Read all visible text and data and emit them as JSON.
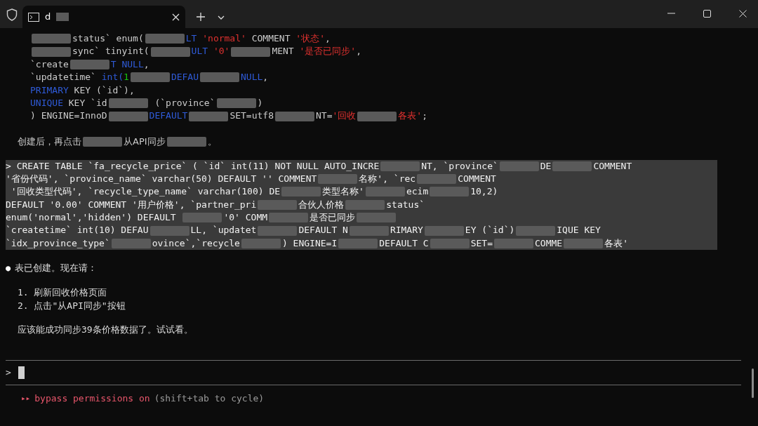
{
  "tab": {
    "title": "d",
    "selected": true
  },
  "code_lines": [
    [
      {
        "kind": "redacted"
      },
      {
        "kind": "plain",
        "text": "status` enum("
      },
      {
        "kind": "redacted"
      },
      {
        "kind": "keyword",
        "text": "LT"
      },
      {
        "kind": "string",
        "text": " 'normal'"
      },
      {
        "kind": "plain",
        "text": " COMMENT "
      },
      {
        "kind": "string",
        "text": "'状态'"
      },
      {
        "kind": "plain",
        "text": ","
      }
    ],
    [
      {
        "kind": "redacted"
      },
      {
        "kind": "plain",
        "text": "sync` tinyint("
      },
      {
        "kind": "redacted"
      },
      {
        "kind": "keyword",
        "text": "ULT"
      },
      {
        "kind": "string",
        "text": " '0'"
      },
      {
        "kind": "redacted"
      },
      {
        "kind": "plain",
        "text": "MENT "
      },
      {
        "kind": "string",
        "text": "'是否已同步'"
      },
      {
        "kind": "plain",
        "text": ","
      }
    ],
    [
      {
        "kind": "plain",
        "text": "`create"
      },
      {
        "kind": "redacted"
      },
      {
        "kind": "keyword",
        "text": "T NULL"
      },
      {
        "kind": "plain",
        "text": ","
      }
    ],
    [
      {
        "kind": "plain",
        "text": "`updatetime` "
      },
      {
        "kind": "keyword",
        "text": "int("
      },
      {
        "kind": "number",
        "text": "1"
      },
      {
        "kind": "redacted"
      },
      {
        "kind": "keyword",
        "text": "DEFAU"
      },
      {
        "kind": "redacted"
      },
      {
        "kind": "keyword",
        "text": "NULL"
      },
      {
        "kind": "plain",
        "text": ","
      }
    ],
    [
      {
        "kind": "keyword",
        "text": "PRIMARY"
      },
      {
        "kind": "plain",
        "text": " KEY (`id`),"
      }
    ],
    [
      {
        "kind": "keyword",
        "text": "UNIQUE"
      },
      {
        "kind": "plain",
        "text": " KEY `id"
      },
      {
        "kind": "redacted"
      },
      {
        "kind": "plain",
        "text": " (`province`"
      },
      {
        "kind": "redacted"
      },
      {
        "kind": "plain",
        "text": ")"
      }
    ],
    [
      {
        "kind": "plain",
        "text": ") ENGINE=InnoD"
      },
      {
        "kind": "redacted"
      },
      {
        "kind": "keyword",
        "text": "DEFAULT"
      },
      {
        "kind": "redacted"
      },
      {
        "kind": "plain",
        "text": "SET=utf8"
      },
      {
        "kind": "redacted"
      },
      {
        "kind": "plain",
        "text": "NT="
      },
      {
        "kind": "string",
        "text": "'回收"
      },
      {
        "kind": "redacted"
      },
      {
        "kind": "string",
        "text": "各表'"
      },
      {
        "kind": "plain",
        "text": ";"
      }
    ]
  ],
  "note_line": [
    {
      "kind": "plain",
      "text": "创建后，再点击"
    },
    {
      "kind": "redacted"
    },
    {
      "kind": "plain",
      "text": "从API同步"
    },
    {
      "kind": "redacted"
    },
    {
      "kind": "plain",
      "text": "。"
    }
  ],
  "selected_lines": [
    [
      {
        "kind": "plain",
        "text": "> CREATE TABLE `fa_recycle_price` ( `id` int(11) NOT NULL AUTO_INCRE"
      },
      {
        "kind": "redacted"
      },
      {
        "kind": "plain",
        "text": "NT, `province`"
      },
      {
        "kind": "redacted"
      },
      {
        "kind": "plain",
        "text": "DE"
      },
      {
        "kind": "redacted"
      },
      {
        "kind": "plain",
        "text": "COMMENT"
      }
    ],
    [
      {
        "kind": "plain",
        "text": "'省份代码', `province_name` varchar(50) DEFAULT '' COMMENT"
      },
      {
        "kind": "redacted"
      },
      {
        "kind": "plain",
        "text": "名称', `rec"
      },
      {
        "kind": "redacted"
      },
      {
        "kind": "plain",
        "text": "COMMENT"
      }
    ],
    [
      {
        "kind": "plain",
        "text": " '回收类型代码', `recycle_type_name` varchar(100) DE"
      },
      {
        "kind": "redacted"
      },
      {
        "kind": "plain",
        "text": "类型名称'"
      },
      {
        "kind": "redacted"
      },
      {
        "kind": "plain",
        "text": "ecim"
      },
      {
        "kind": "redacted"
      },
      {
        "kind": "plain",
        "text": "10,2)"
      }
    ],
    [
      {
        "kind": "plain",
        "text": "DEFAULT '0.00' COMMENT '用户价格', `partner_pri"
      },
      {
        "kind": "redacted"
      },
      {
        "kind": "plain",
        "text": "合伙人价格"
      },
      {
        "kind": "redacted"
      },
      {
        "kind": "plain",
        "text": "status`"
      }
    ],
    [
      {
        "kind": "plain",
        "text": "enum('normal','hidden') DEFAULT "
      },
      {
        "kind": "redacted"
      },
      {
        "kind": "plain",
        "text": "'0' COMM"
      },
      {
        "kind": "redacted"
      },
      {
        "kind": "plain",
        "text": "是否已同步"
      },
      {
        "kind": "redacted"
      }
    ],
    [
      {
        "kind": "plain",
        "text": "`createtime` int(10) DEFAU"
      },
      {
        "kind": "redacted"
      },
      {
        "kind": "plain",
        "text": "LL, `updatet"
      },
      {
        "kind": "redacted"
      },
      {
        "kind": "plain",
        "text": "DEFAULT N"
      },
      {
        "kind": "redacted"
      },
      {
        "kind": "plain",
        "text": "RIMARY"
      },
      {
        "kind": "redacted"
      },
      {
        "kind": "plain",
        "text": "EY (`id`)"
      },
      {
        "kind": "redacted"
      },
      {
        "kind": "plain",
        "text": "IQUE KEY"
      }
    ],
    [
      {
        "kind": "plain",
        "text": "`idx_province_type`"
      },
      {
        "kind": "redacted"
      },
      {
        "kind": "plain",
        "text": "ovince`,`recycle"
      },
      {
        "kind": "redacted"
      },
      {
        "kind": "plain",
        "text": ") ENGINE=I"
      },
      {
        "kind": "redacted"
      },
      {
        "kind": "plain",
        "text": "DEFAULT C"
      },
      {
        "kind": "redacted"
      },
      {
        "kind": "plain",
        "text": "SET="
      },
      {
        "kind": "redacted"
      },
      {
        "kind": "plain",
        "text": "COMME"
      },
      {
        "kind": "redacted"
      },
      {
        "kind": "plain",
        "text": "各表'"
      }
    ]
  ],
  "reply": {
    "bullet": "●",
    "message": "表已创建。现在请：",
    "steps": [
      "1. 刷新回收价格页面",
      "2. 点击\"从API同步\"按钮"
    ],
    "closing": "应该能成功同步39条价格数据了。试试看。"
  },
  "prompt": {
    "symbol": ">"
  },
  "mode": {
    "arrows": "▸▸",
    "label": "bypass permissions on",
    "hint": "(shift+tab to cycle)"
  }
}
